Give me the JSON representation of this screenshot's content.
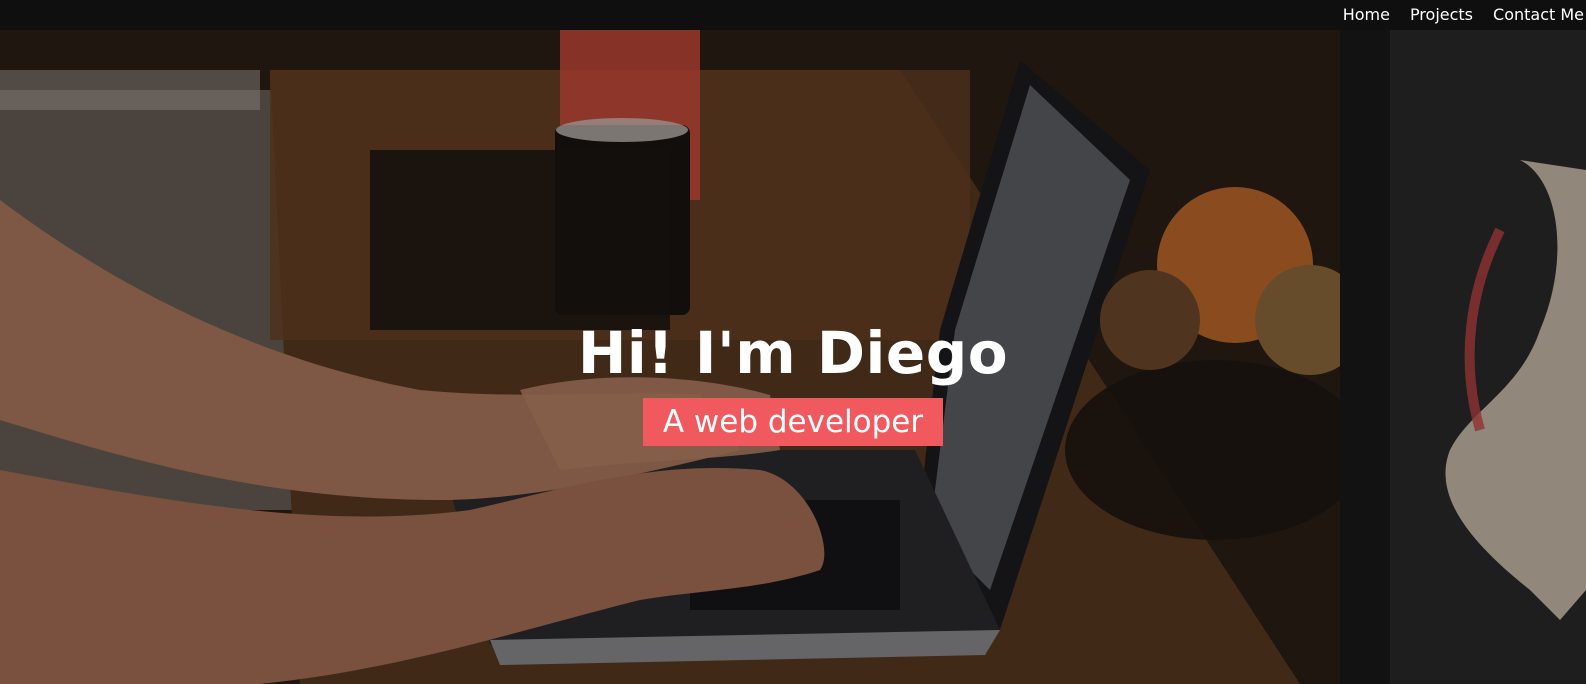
{
  "nav": {
    "links": [
      {
        "label": "Home"
      },
      {
        "label": "Projects"
      },
      {
        "label": "Contact Me"
      }
    ]
  },
  "hero": {
    "title": "Hi! I'm Diego",
    "subtitle": "A web developer",
    "accent_color": "#f05a5f",
    "background_description_icon": "photo-laptop-hands-icon"
  }
}
